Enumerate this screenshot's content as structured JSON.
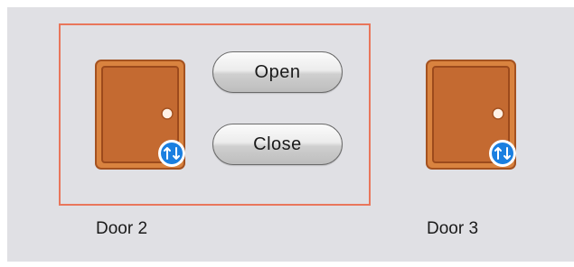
{
  "doors": [
    {
      "label": "Door 2",
      "icon": "door-icon",
      "badge_icon": "swap-arrows-icon",
      "selected": true
    },
    {
      "label": "Door 3",
      "icon": "door-icon",
      "badge_icon": "swap-arrows-icon",
      "selected": false
    }
  ],
  "actions": {
    "open_label": "Open",
    "close_label": "Close"
  },
  "colors": {
    "background": "#e0e0e4",
    "selection_border": "#e9765b",
    "door_wood": "#c76a33",
    "badge": "#1a7fe0"
  }
}
